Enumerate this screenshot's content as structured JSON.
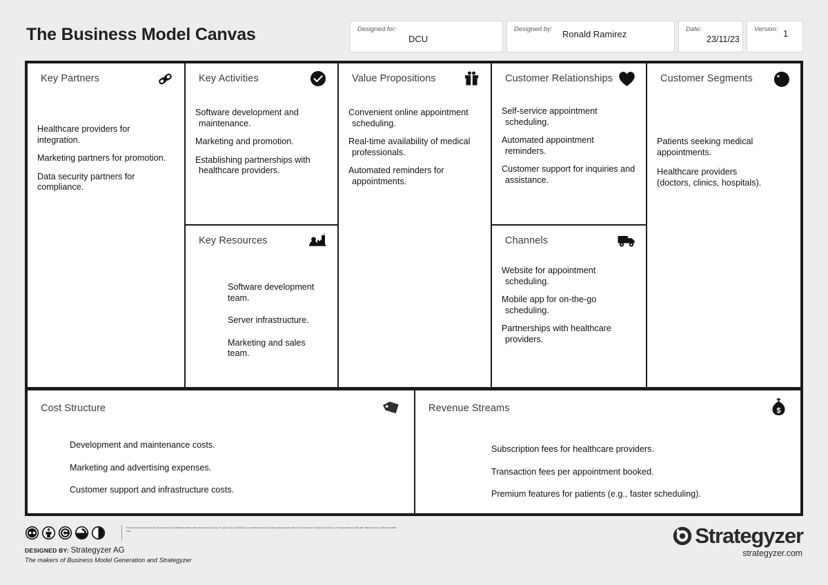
{
  "header": {
    "title": "The Business Model Canvas",
    "meta": [
      {
        "key": "designed_for",
        "label": "Designed for:",
        "value": "DCU"
      },
      {
        "key": "designed_by",
        "label": "Designed by:",
        "value": "Ronald Ramirez"
      },
      {
        "key": "date",
        "label": "Date:",
        "value": "23/11/23"
      },
      {
        "key": "version",
        "label": "Version:",
        "value": "1"
      }
    ]
  },
  "blocks": {
    "key_partners": {
      "title": "Key Partners",
      "icon": "chain-link-icon",
      "entries": [
        "Healthcare providers for integration.",
        "Marketing partners for promotion.",
        "Data security partners for compliance."
      ]
    },
    "key_activities": {
      "title": "Key Activities",
      "icon": "check-circle-icon",
      "entries": [
        "Software development and maintenance.",
        "Marketing and promotion.",
        "Establishing partnerships with healthcare providers."
      ]
    },
    "key_resources": {
      "title": "Key Resources",
      "icon": "factory-worker-icon",
      "entries": [
        "Software development team.",
        "Server infrastructure.",
        "Marketing and sales team."
      ]
    },
    "value_propositions": {
      "title": "Value Propositions",
      "icon": "gift-icon",
      "entries": [
        "Convenient online appointment scheduling.",
        "Real-time availability of medical professionals.",
        "Automated reminders for appointments."
      ]
    },
    "customer_relationships": {
      "title": "Customer Relationships",
      "icon": "heart-icon",
      "entries": [
        "Self-service appointment scheduling.",
        "Automated appointment reminders.",
        "Customer support for inquiries and assistance."
      ]
    },
    "channels": {
      "title": "Channels",
      "icon": "delivery-truck-icon",
      "entries": [
        "Website for appointment scheduling.",
        "Mobile app for on-the-go scheduling.",
        "Partnerships with healthcare providers."
      ]
    },
    "customer_segments": {
      "title": "Customer Segments",
      "icon": "customer-face-icon",
      "entries": [
        "Patients seeking medical appointments.",
        "Healthcare providers\n(doctors, clinics, hospitals)."
      ]
    },
    "cost_structure": {
      "title": "Cost Structure",
      "icon": "price-tag-icon",
      "entries": [
        "Development and maintenance costs.",
        "Marketing and advertising expenses.",
        "Customer support and infrastructure costs."
      ]
    },
    "revenue_streams": {
      "title": "Revenue Streams",
      "icon": "money-bag-icon",
      "entries": [
        "Subscription fees for healthcare providers.",
        "Transaction fees per appointment booked.",
        "Premium features for patients (e.g., faster scheduling)."
      ]
    }
  },
  "footer": {
    "license_text": "This work is licensed under the Creative Commons Attribution-Share Alike 3.0 Unported License. To view a copy of this license, visit http://creativecommons.org/licenses/by-sa/3.0/ or send a letter to Creative Commons, 171 Second Street, Suite 300, San Francisco, California, 94105, USA.",
    "designed_by_label": "DESIGNED BY:",
    "designed_by_name": "Strategyzer AG",
    "makers": "The makers of Business Model Generation and Strategyzer",
    "brand_name": "Strategyzer",
    "brand_url": "strategyzer.com",
    "cc_badges": [
      "creative-commons-icon",
      "attribution-person-icon",
      "copyleft-icon",
      "share-alike-icon",
      "half-circle-icon"
    ]
  },
  "colors": {
    "page_background": "#ededed",
    "canvas_border": "#1a1a1a",
    "cell_background": "#ffffff",
    "title_text": "#231f20",
    "heading_text": "#3a3a3a"
  }
}
